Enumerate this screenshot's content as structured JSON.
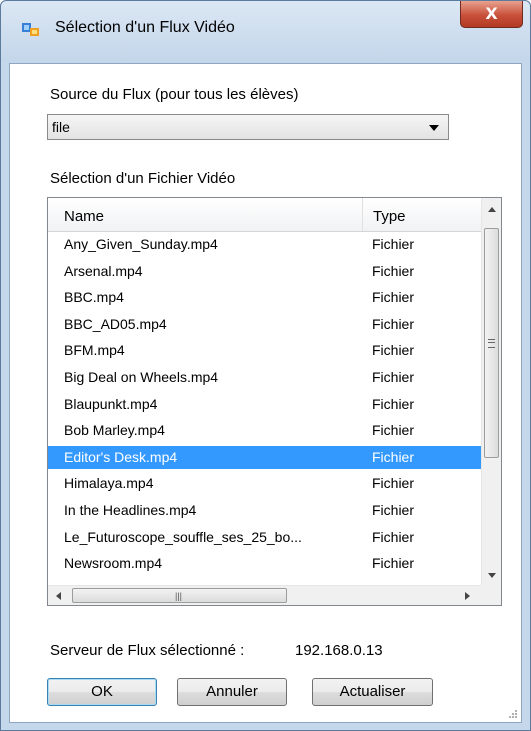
{
  "window": {
    "title": "Sélection d'un Flux Vidéo",
    "close_glyph": "X",
    "title_icon": "app-icon"
  },
  "source": {
    "label": "Source du Flux (pour tous les élèves)",
    "value": "file"
  },
  "file_list": {
    "label": "Sélection d'un Fichier Vidéo",
    "columns": [
      "Name",
      "Type"
    ],
    "rows": [
      {
        "name": "Any_Given_Sunday.mp4",
        "type": "Fichier"
      },
      {
        "name": "Arsenal.mp4",
        "type": "Fichier"
      },
      {
        "name": "BBC.mp4",
        "type": "Fichier"
      },
      {
        "name": "BBC_AD05.mp4",
        "type": "Fichier"
      },
      {
        "name": "BFM.mp4",
        "type": "Fichier"
      },
      {
        "name": "Big Deal on Wheels.mp4",
        "type": "Fichier"
      },
      {
        "name": "Blaupunkt.mp4",
        "type": "Fichier"
      },
      {
        "name": "Bob Marley.mp4",
        "type": "Fichier"
      },
      {
        "name": "Editor's Desk.mp4",
        "type": "Fichier"
      },
      {
        "name": "Himalaya.mp4",
        "type": "Fichier"
      },
      {
        "name": "In the Headlines.mp4",
        "type": "Fichier"
      },
      {
        "name": "Le_Futuroscope_souffle_ses_25_bo...",
        "type": "Fichier"
      },
      {
        "name": "Newsroom.mp4",
        "type": "Fichier"
      }
    ],
    "selected_index": 8,
    "selection_color": "#3399ff"
  },
  "server": {
    "label": "Serveur de Flux sélectionné :",
    "address": "192.168.0.13"
  },
  "buttons": {
    "ok": "OK",
    "cancel": "Annuler",
    "refresh": "Actualiser"
  }
}
